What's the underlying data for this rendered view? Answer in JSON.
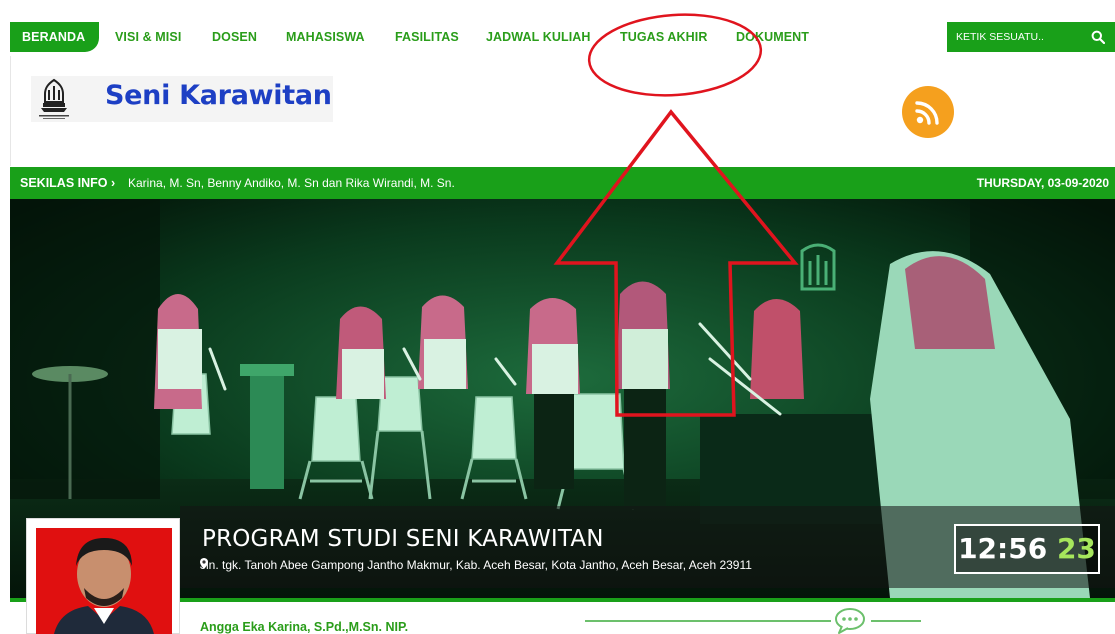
{
  "nav": {
    "items": [
      {
        "label": "BERANDA",
        "active": true
      },
      {
        "label": "VISI & MISI"
      },
      {
        "label": "DOSEN"
      },
      {
        "label": "MAHASISWA"
      },
      {
        "label": "FASILITAS"
      },
      {
        "label": "JADWAL KULIAH"
      },
      {
        "label": "TUGAS AKHIR"
      },
      {
        "label": "DOKUMENT"
      }
    ],
    "search_placeholder": "KETIK SESUATU.."
  },
  "header": {
    "site_title": "Seni Karawitan",
    "logo_icon": "institute-emblem-icon",
    "rss_icon": "rss-icon"
  },
  "infobar": {
    "label": "SEKILAS INFO",
    "text": "Karina, M. Sn, Benny Andiko, M. Sn dan Rika Wirandi, M. Sn.",
    "date": "THURSDAY, 03-09-2020"
  },
  "hero": {
    "title": "PROGRAM STUDI SENI KARAWITAN",
    "address": "Jln. tgk. Tanoh Abee Gampong Jantho Makmur, Kab. Aceh Besar, Kota Jantho, Aceh Besar, Aceh 23911",
    "clock": {
      "hm": "12:56",
      "sec": "23"
    }
  },
  "profile": {
    "name": "Angga Eka Karina, S.Pd.,M.Sn. NIP."
  },
  "colors": {
    "brand_green": "#19a019",
    "title_blue": "#1d3fc4",
    "rss_orange": "#f5a01e",
    "annotation_red": "#e0141e"
  }
}
